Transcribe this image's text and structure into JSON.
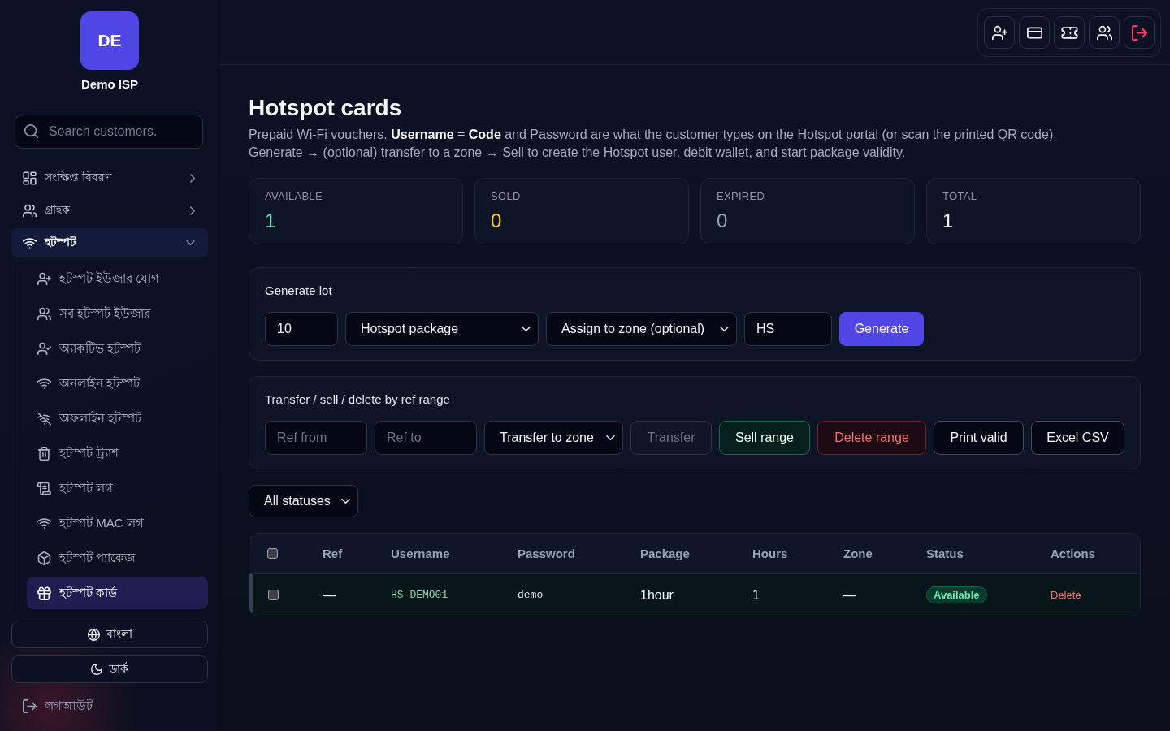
{
  "sidebar": {
    "logo": "DE",
    "name": "Demo ISP",
    "search": {
      "placeholder": "Search customers."
    },
    "nav": [
      {
        "label": "সংক্ষিপ্ত বিবরণ",
        "expanded": false
      },
      {
        "label": "গ্রাহক",
        "expanded": false
      },
      {
        "label": "হটস্পট",
        "expanded": true,
        "children": [
          {
            "label": "হটস্পট ইউজার যোগ",
            "selected": false
          },
          {
            "label": "সব হটস্পট ইউজার",
            "selected": false
          },
          {
            "label": "অ্যাকটিভ হটস্পট",
            "selected": false
          },
          {
            "label": "অনলাইন হটস্পট",
            "selected": false
          },
          {
            "label": "অফলাইন হটস্পট",
            "selected": false
          },
          {
            "label": "হটস্পট ট্র্যাশ",
            "selected": false
          },
          {
            "label": "হটস্পট লগ",
            "selected": false
          },
          {
            "label": "হটস্পট MAC লগ",
            "selected": false
          },
          {
            "label": "হটস্পট প্যাকেজ",
            "selected": false
          },
          {
            "label": "হটস্পট কার্ড",
            "selected": true
          }
        ]
      }
    ],
    "language": "বাংলা",
    "theme": "ডার্ক",
    "logout": "লগআউট"
  },
  "page": {
    "title": "Hotspot cards",
    "description": "Prepaid Wi-Fi vouchers. **Username = Code** and Password are what the customer types on the Hotspot portal (or scan the printed QR code). Generate → (optional) transfer to a zone → Sell to create the Hotspot user, debit wallet, and start package validity."
  },
  "stats": [
    {
      "label": "AVAILABLE",
      "value": "1",
      "color": "#6ee7b7"
    },
    {
      "label": "SOLD",
      "value": "0",
      "color": "#facc15"
    },
    {
      "label": "EXPIRED",
      "value": "0",
      "color": "#94a3b8"
    },
    {
      "label": "TOTAL",
      "value": "1",
      "color": "#f1f5f9"
    }
  ],
  "generate": {
    "title": "Generate lot",
    "controls": [
      {
        "kind": "input",
        "value": "10"
      },
      {
        "kind": "select",
        "value": "Hotspot package"
      },
      {
        "kind": "select",
        "value": "Assign to zone (optional)"
      },
      {
        "kind": "input",
        "value": "HS"
      },
      {
        "kind": "primary",
        "label": "Generate",
        "disabled": false
      }
    ]
  },
  "transfer": {
    "title": "Transfer / sell / delete by ref range",
    "controls": [
      {
        "kind": "input",
        "placeholder": "Ref from"
      },
      {
        "kind": "input",
        "placeholder": "Ref to"
      },
      {
        "kind": "select",
        "value": "Transfer to zone"
      },
      {
        "kind": "outline",
        "label": "Transfer",
        "disabled": true
      },
      {
        "kind": "success",
        "label": "Sell range",
        "disabled": false
      },
      {
        "kind": "danger",
        "label": "Delete range",
        "disabled": false
      },
      {
        "kind": "outline",
        "label": "Print valid",
        "disabled": false
      },
      {
        "kind": "outline",
        "label": "Excel CSV",
        "disabled": false
      }
    ]
  },
  "filter": {
    "value": "All statuses"
  },
  "table": {
    "select_all": false,
    "columns": [
      "Ref",
      "Username",
      "Password",
      "Package",
      "Hours",
      "Zone",
      "Status",
      "Actions"
    ],
    "rows": [
      {
        "checked": false,
        "ref": "—",
        "username": "HS-DEMO01",
        "password": "demo",
        "package": "1hour",
        "hours": "1",
        "zone": "—",
        "status": "Available",
        "action": "Delete"
      }
    ]
  }
}
